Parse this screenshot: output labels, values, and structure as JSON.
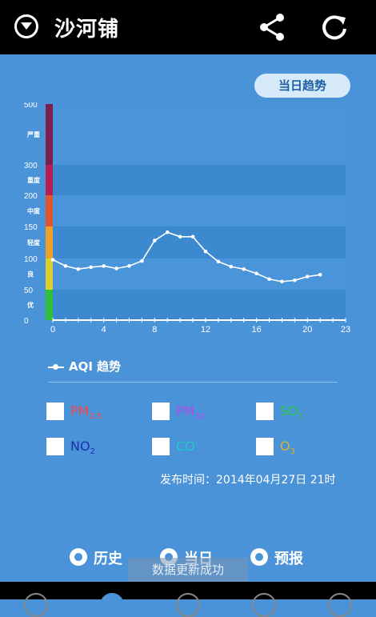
{
  "header": {
    "title": "沙河铺"
  },
  "trend_button": "当日趋势",
  "chart_data": {
    "type": "line",
    "x": [
      0,
      1,
      2,
      3,
      4,
      5,
      6,
      7,
      8,
      9,
      10,
      11,
      12,
      13,
      14,
      15,
      16,
      17,
      18,
      19,
      20,
      21
    ],
    "y": [
      98,
      88,
      83,
      86,
      88,
      84,
      88,
      96,
      128,
      141,
      134,
      134,
      111,
      95,
      87,
      83,
      76,
      67,
      63,
      65,
      71,
      74
    ],
    "xticks": [
      "0",
      "4",
      "8",
      "12",
      "16",
      "20",
      "23"
    ],
    "xlim": [
      0,
      23
    ],
    "yticks": [
      "0",
      "50",
      "100",
      "150",
      "200",
      "300",
      "500"
    ],
    "level_labels": [
      "优",
      "良",
      "轻度",
      "中度",
      "重度",
      "严重"
    ],
    "level_colors": [
      "#2fbf3a",
      "#d9cf2e",
      "#eea028",
      "#e2562f",
      "#b81c51",
      "#7c1f4e"
    ],
    "legend": "AQI 趋势"
  },
  "pollutants": [
    {
      "name": "PM",
      "sub": "2.5",
      "color": "#ff4444"
    },
    {
      "name": "PM",
      "sub": "10",
      "color": "#b34cf0"
    },
    {
      "name": "SO",
      "sub": "2",
      "color": "#2ec74a"
    },
    {
      "name": "NO",
      "sub": "2",
      "color": "#1a2fb0"
    },
    {
      "name": "CO",
      "sub": "",
      "color": "#21c9c9"
    },
    {
      "name": "O",
      "sub": "3",
      "color": "#d4b22a"
    }
  ],
  "publish_time": "发布时间：2014年04月27日 21时",
  "radios": [
    "历史",
    "当日",
    "预报"
  ],
  "toast": "数据更新成功"
}
